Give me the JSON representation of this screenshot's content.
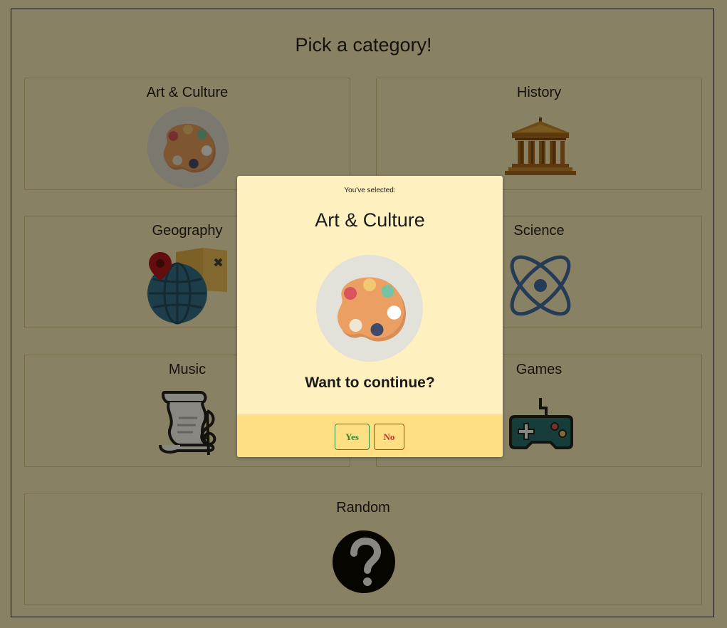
{
  "page": {
    "title": "Pick a category!"
  },
  "categories": [
    {
      "label": "Art & Culture",
      "icon": "palette-icon"
    },
    {
      "label": "History",
      "icon": "museum-icon"
    },
    {
      "label": "Geography",
      "icon": "globe-map-icon"
    },
    {
      "label": "Science",
      "icon": "atom-icon"
    },
    {
      "label": "Music",
      "icon": "sheet-music-icon"
    },
    {
      "label": "Games",
      "icon": "gamepad-icon"
    },
    {
      "label": "Random",
      "icon": "question-mark-icon"
    }
  ],
  "modal": {
    "subtitle": "You've selected:",
    "selected": "Art & Culture",
    "selected_icon": "palette-icon",
    "question": "Want to continue?",
    "yes_label": "Yes",
    "no_label": "No"
  },
  "colors": {
    "background": "#fff3c2",
    "modal_background": "#fff0c0",
    "modal_footer": "#ffdf83",
    "yes": "#2e8b3a",
    "no": "#c0392b"
  }
}
